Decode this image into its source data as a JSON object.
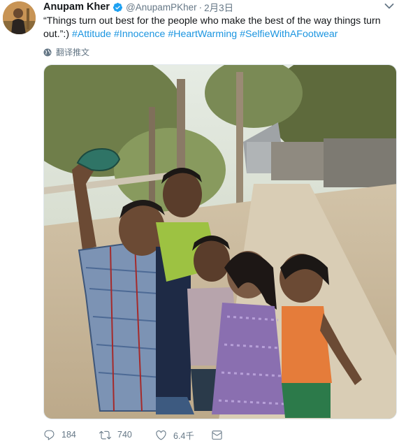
{
  "tweet": {
    "author_name": "Anupam Kher",
    "handle": "@AnupamPKher",
    "separator": "·",
    "date": "2月3日",
    "text_main": "“Things turn out best for the people who make the best of the way things turn out.”:)",
    "hashtags": [
      "#Attitude",
      "#Innocence",
      "#HeartWarming",
      "#SelfieWithAFootwear"
    ],
    "translate_label": "翻译推文",
    "photo_alt": "",
    "replies": "184",
    "retweets": "740",
    "likes": "6.4千",
    "colors": {
      "link": "#1b95e0",
      "verified": "#1da1f2",
      "secondary": "#657786",
      "text": "#14171a"
    },
    "icons": {
      "verified": "verified-badge-icon",
      "chevron": "chevron-down-icon",
      "translate": "globe-icon",
      "reply": "reply-icon",
      "retweet": "retweet-icon",
      "like": "heart-icon",
      "dm": "envelope-icon"
    }
  }
}
